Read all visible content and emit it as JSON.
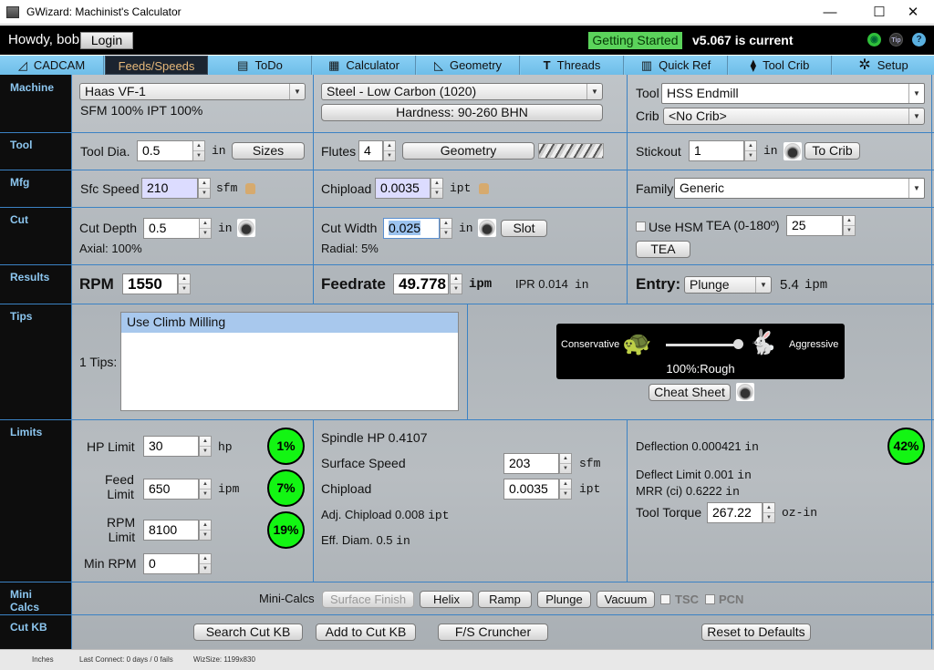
{
  "window": {
    "title": "GWizard: Machinist's Calculator",
    "controls": {
      "minimize": "—",
      "maximize": "☐",
      "close": "✕"
    }
  },
  "topbar": {
    "greeting": "Howdy, bob!",
    "login_label": "Login",
    "getting_started_label": "Getting Started",
    "version_text": "v5.067 is current",
    "icons": {
      "support": "support-icon",
      "tip": "Tip",
      "help": "?"
    }
  },
  "tabs": [
    {
      "label": "CADCAM",
      "icon": "◿",
      "active": false
    },
    {
      "label": "Feeds/Speeds",
      "icon": "",
      "active": true
    },
    {
      "label": "ToDo",
      "icon": "▤",
      "active": false
    },
    {
      "label": "Calculator",
      "icon": "▦",
      "active": false
    },
    {
      "label": "Geometry",
      "icon": "◺",
      "active": false
    },
    {
      "label": "Threads",
      "icon": "T",
      "active": false
    },
    {
      "label": "Quick Ref",
      "icon": "▥",
      "active": false
    },
    {
      "label": "Tool Crib",
      "icon": "⧫",
      "active": false
    },
    {
      "label": "Setup",
      "icon": "✲",
      "active": false
    }
  ],
  "sections": {
    "machine": "Machine",
    "tool": "Tool",
    "mfg": "Mfg",
    "cut": "Cut",
    "results": "Results",
    "tips": "Tips",
    "limits": "Limits",
    "mini_calcs": "Mini Calcs",
    "cut_kb": "Cut KB"
  },
  "machine": {
    "machine_select": "Haas VF-1",
    "sfm_ipt_text": "SFM 100% IPT 100%",
    "material_select": "Steel - Low Carbon (1020)",
    "hardness_button": "Hardness: 90-260 BHN",
    "tool_label": "Tool",
    "tool_select": "HSS Endmill",
    "crib_label": "Crib",
    "crib_select": "<No Crib>"
  },
  "tool": {
    "dia_label": "Tool Dia.",
    "dia_value": "0.5",
    "dia_unit": "in",
    "sizes_button": "Sizes",
    "flutes_label": "Flutes",
    "flutes_value": "4",
    "geometry_button": "Geometry",
    "stickout_label": "Stickout",
    "stickout_value": "1",
    "stickout_unit": "in",
    "to_crib_button": "To Crib"
  },
  "mfg": {
    "sfc_label": "Sfc Speed",
    "sfc_value": "210",
    "sfc_unit": "sfm",
    "chipload_label": "Chipload",
    "chipload_value": "0.0035",
    "chipload_unit": "ipt",
    "family_label": "Family:",
    "family_select": "Generic"
  },
  "cut": {
    "depth_label": "Cut Depth",
    "depth_value": "0.5",
    "depth_unit": "in",
    "axial_text": "Axial: 100%",
    "width_label": "Cut Width",
    "width_value": "0.025",
    "width_unit": "in",
    "slot_button": "Slot",
    "radial_text": "Radial: 5%",
    "hsm_label": "Use HSM",
    "hsm_checked": false,
    "tea_label": "TEA (0-180º)",
    "tea_value": "25",
    "tea_button": "TEA"
  },
  "results": {
    "rpm_label": "RPM",
    "rpm_value": "1550",
    "feedrate_label": "Feedrate",
    "feedrate_value": "49.778",
    "feedrate_unit": "ipm",
    "ipr_label": "IPR 0.014",
    "ipr_unit": "in",
    "entry_label": "Entry:",
    "entry_select": "Plunge",
    "entry_rate": "5.4",
    "entry_unit": "ipm"
  },
  "tips": {
    "count_label": "1 Tips:",
    "items": [
      "Use Climb Milling"
    ],
    "slider": {
      "left_label": "Conservative",
      "right_label": "Aggressive",
      "value_pct": 100,
      "value_text": "100%:Rough"
    },
    "cheat_sheet_button": "Cheat Sheet"
  },
  "limits": {
    "hp_label": "HP Limit",
    "hp_value": "30",
    "hp_unit": "hp",
    "hp_pct": "1%",
    "feed_label_1": "Feed",
    "feed_label_2": "Limit",
    "feed_value": "650",
    "feed_unit": "ipm",
    "feed_pct": "7%",
    "rpm_label_1": "RPM",
    "rpm_label_2": "Limit",
    "rpm_value": "8100",
    "rpm_pct": "19%",
    "min_rpm_label": "Min RPM",
    "min_rpm_value": "0",
    "spindle_hp": "Spindle HP 0.4107",
    "surface_speed_label": "Surface Speed",
    "surface_speed_value": "203",
    "surface_speed_unit": "sfm",
    "chipload_label": "Chipload",
    "chipload_value": "0.0035",
    "chipload_unit": "ipt",
    "adj_chipload": "Adj. Chipload 0.008",
    "adj_chipload_unit": "ipt",
    "eff_diam": "Eff. Diam. 0.5",
    "eff_diam_unit": "in",
    "deflection": "Deflection 0.000421",
    "deflection_unit": "in",
    "deflection_pct": "42%",
    "deflect_limit": "Deflect Limit 0.001",
    "deflect_limit_unit": "in",
    "mrr": "MRR (ci) 0.6222",
    "mrr_unit": "in",
    "torque_label": "Tool Torque",
    "torque_value": "267.22",
    "torque_unit": "oz-in"
  },
  "mini_calcs": {
    "label": "Mini-Calcs",
    "buttons": [
      "Surface Finish",
      "Helix",
      "Ramp",
      "Plunge",
      "Vacuum"
    ],
    "tsc_label": "TSC",
    "pcn_label": "PCN"
  },
  "cut_kb": {
    "search_button": "Search Cut KB",
    "add_button": "Add to Cut KB",
    "cruncher_button": "F/S Cruncher",
    "reset_button": "Reset to Defaults"
  },
  "statusbar": {
    "units": "Inches",
    "last_connect": "Last Connect: 0 days / 0 fails",
    "wiz_size": "WizSize: 1199x830"
  },
  "colors": {
    "tab_bg": "#7fc8f0",
    "active_tab_bg": "#1b2430",
    "section_label": "#8cc6ef",
    "grid_line": "#3b82c4",
    "getting_started": "#5bd35b",
    "pct_badge": "#13f513"
  }
}
